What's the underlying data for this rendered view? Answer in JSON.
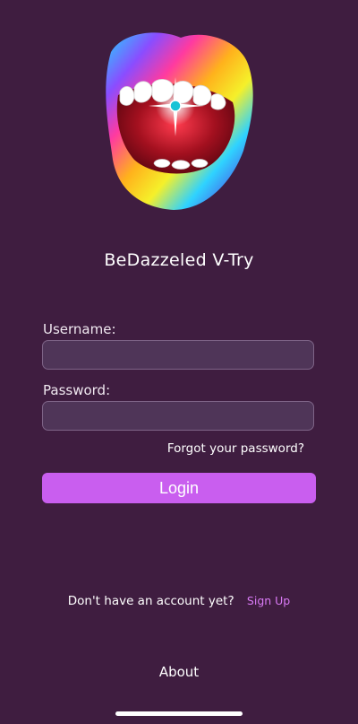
{
  "app": {
    "title": "BeDazzeled V-Try",
    "logo_icon": "rainbow-lips-jeweled-tooth-icon"
  },
  "login_form": {
    "username_label": "Username:",
    "username_value": "",
    "password_label": "Password:",
    "password_value": "",
    "forgot_password_label": "Forgot your password?",
    "login_label": "Login"
  },
  "signup": {
    "prompt": "Don't have an account yet?",
    "link_label": "Sign Up"
  },
  "footer": {
    "about_label": "About"
  },
  "colors": {
    "background": "#3f1d40",
    "input_fill": "#4f3558",
    "input_border": "#7e6487",
    "accent": "#c95eef",
    "link": "#d97af5",
    "text": "#ffffff"
  }
}
